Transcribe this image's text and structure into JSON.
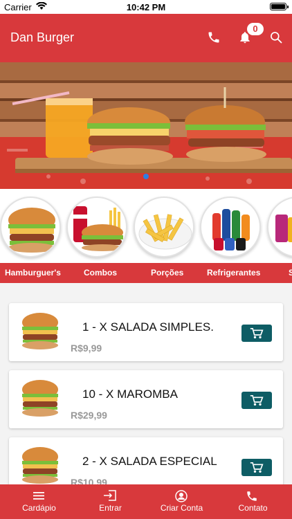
{
  "status_bar": {
    "carrier": "Carrier",
    "time": "10:42 PM"
  },
  "app_bar": {
    "title": "Dan Burger",
    "notification_count": "0",
    "icons": [
      "phone-icon",
      "bell-icon",
      "search-icon"
    ]
  },
  "banner": {
    "carousel_pages": 1,
    "active_page": 1
  },
  "categories": [
    {
      "label": "Hamburguer's",
      "icon": "burger-image"
    },
    {
      "label": "Combos",
      "icon": "combo-image"
    },
    {
      "label": "Porções",
      "icon": "fries-image"
    },
    {
      "label": "Refrigerantes",
      "icon": "sodas-image"
    },
    {
      "label": "S",
      "icon": "drinks-image"
    }
  ],
  "products": [
    {
      "name": "1 - X SALADA SIMPLES.",
      "price": "R$9,99"
    },
    {
      "name": "10 - X MAROMBA",
      "price": "R$29,99"
    },
    {
      "name": "2 - X SALADA ESPECIAL",
      "price": "R$10,99"
    }
  ],
  "tab_bar": [
    {
      "label": "Cardápio",
      "icon": "menu-icon"
    },
    {
      "label": "Entrar",
      "icon": "login-icon"
    },
    {
      "label": "Criar Conta",
      "icon": "account-icon"
    },
    {
      "label": "Contato",
      "icon": "phone-icon"
    }
  ],
  "colors": {
    "primary": "#d8393c",
    "cart_button": "#0e5d65",
    "price": "#999999"
  }
}
